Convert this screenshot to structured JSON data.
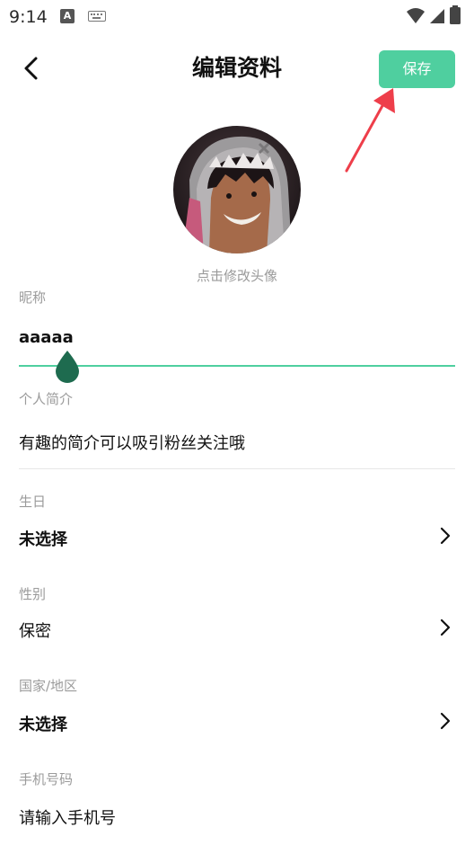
{
  "status_bar": {
    "time": "9:14",
    "icons": [
      "text-a-icon",
      "keyboard-icon",
      "wifi-icon",
      "signal-icon",
      "battery-icon"
    ]
  },
  "header": {
    "back_icon": "chevron-left-icon",
    "title": "编辑资料",
    "save_label": "保存"
  },
  "profile": {
    "avatar_caption": "点击修改头像"
  },
  "form": {
    "nickname": {
      "label": "昵称",
      "value": "aaaaa"
    },
    "bio": {
      "label": "个人简介",
      "value": "有趣的简介可以吸引粉丝关注哦"
    },
    "birthday": {
      "label": "生日",
      "value": "未选择"
    },
    "gender": {
      "label": "性别",
      "value": "保密"
    },
    "region": {
      "label": "国家/地区",
      "value": "未选择"
    },
    "phone": {
      "label": "手机号码",
      "placeholder": "请输入手机号"
    }
  },
  "colors": {
    "accent": "#4fcf9f",
    "cursor_handle": "#1e6b4f",
    "annotation_arrow": "#ee3e4a",
    "label_gray": "#9b9b9b"
  }
}
